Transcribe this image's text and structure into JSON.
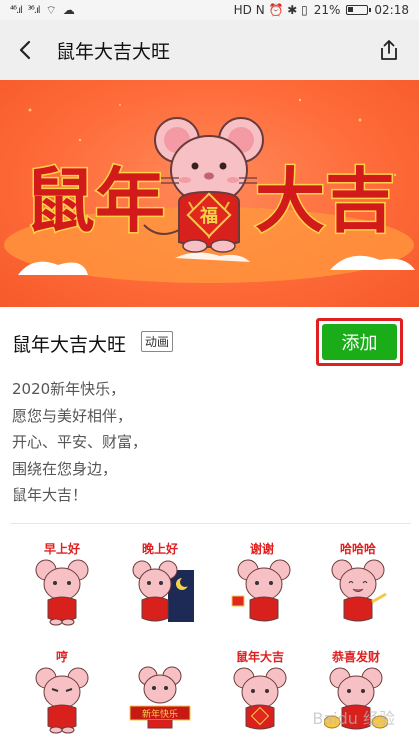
{
  "status_bar": {
    "left_signal_1": "⁴⁶.ıl",
    "left_signal_2": "³⁶.ıl",
    "right_icons": "HD N ⏰ ✱ ▯",
    "battery": "21%",
    "time": "02:18"
  },
  "header": {
    "title": "鼠年大吉大旺"
  },
  "banner": {
    "text_left": "鼠年",
    "text_right": "大吉",
    "fu": "福"
  },
  "pack": {
    "title": "鼠年大吉大旺",
    "badge": "动画",
    "add_label": "添加",
    "description": [
      "2020新年快乐，",
      "愿您与美好相伴，",
      "开心、平安、财富，",
      "围绕在您身边，",
      "鼠年大吉！"
    ]
  },
  "stickers": [
    {
      "label": "早上好"
    },
    {
      "label": "晚上好"
    },
    {
      "label": "谢谢"
    },
    {
      "label": "哈哈哈"
    },
    {
      "label": "哼"
    },
    {
      "label": "",
      "banner": "新年快乐"
    },
    {
      "label": "鼠年大吉"
    },
    {
      "label": "恭喜发财"
    }
  ],
  "watermark": "Baidu 经验",
  "colors": {
    "accent_green": "#1aad19",
    "highlight_red": "#e02020",
    "banner_orange": "#ff6b3a"
  }
}
